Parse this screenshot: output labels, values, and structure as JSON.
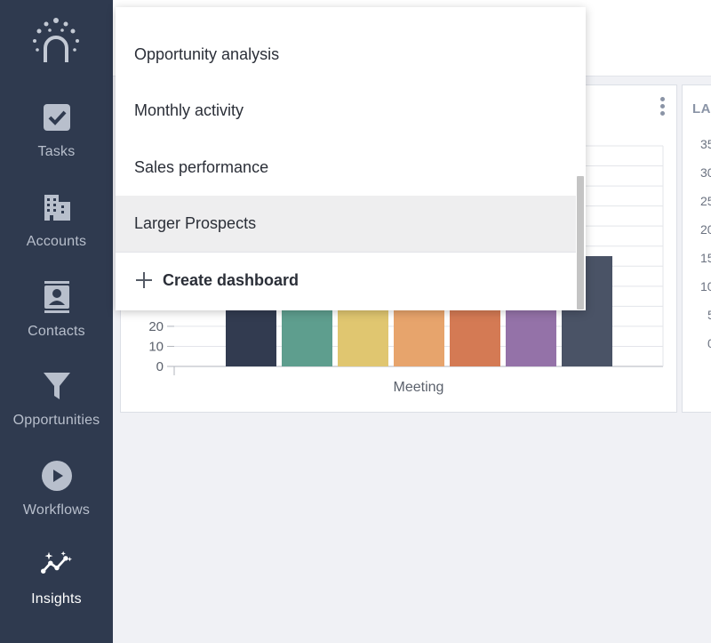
{
  "sidebar": {
    "items": [
      {
        "label": "Tasks",
        "icon": "check-square-icon",
        "active": false
      },
      {
        "label": "Accounts",
        "icon": "building-icon",
        "active": false
      },
      {
        "label": "Contacts",
        "icon": "contact-card-icon",
        "active": false
      },
      {
        "label": "Opportunities",
        "icon": "funnel-icon",
        "active": false
      },
      {
        "label": "Workflows",
        "icon": "play-circle-icon",
        "active": false
      },
      {
        "label": "Insights",
        "icon": "sparkle-trend-icon",
        "active": true
      }
    ]
  },
  "dropdown": {
    "items": [
      {
        "label": "Opportunity analysis",
        "highlighted": false
      },
      {
        "label": "Monthly activity",
        "highlighted": false
      },
      {
        "label": "Sales performance",
        "highlighted": false
      },
      {
        "label": "Larger Prospects",
        "highlighted": true
      }
    ],
    "create_label": "Create dashboard"
  },
  "main_widget": {
    "chart_data": {
      "type": "bar",
      "categories": [
        "Meeting"
      ],
      "xlabel": "Meeting",
      "ylim": [
        0,
        110
      ],
      "y_ticks_visible": [
        "20",
        "10",
        "0"
      ],
      "series": [
        {
          "values": [
            55
          ],
          "color": "#323b50"
        },
        {
          "values": [
            55
          ],
          "color": "#5e9e8e"
        },
        {
          "values": [
            55
          ],
          "color": "#e0c670"
        },
        {
          "values": [
            55
          ],
          "color": "#e7a46c"
        },
        {
          "values": [
            55
          ],
          "color": "#d47a54"
        },
        {
          "values": [
            55
          ],
          "color": "#9472a8"
        },
        {
          "values": [
            55
          ],
          "color": "#4a5366"
        }
      ]
    }
  },
  "side_widget": {
    "title": "LA",
    "y_ticks": [
      "35",
      "30",
      "25",
      "20",
      "15",
      "10",
      "5",
      "0"
    ]
  },
  "colors": {
    "sidebar_bg": "#2f3a4f",
    "sidebar_text": "#b8bfcc",
    "active_text": "#ffffff",
    "page_bg": "#f0f1f5"
  }
}
